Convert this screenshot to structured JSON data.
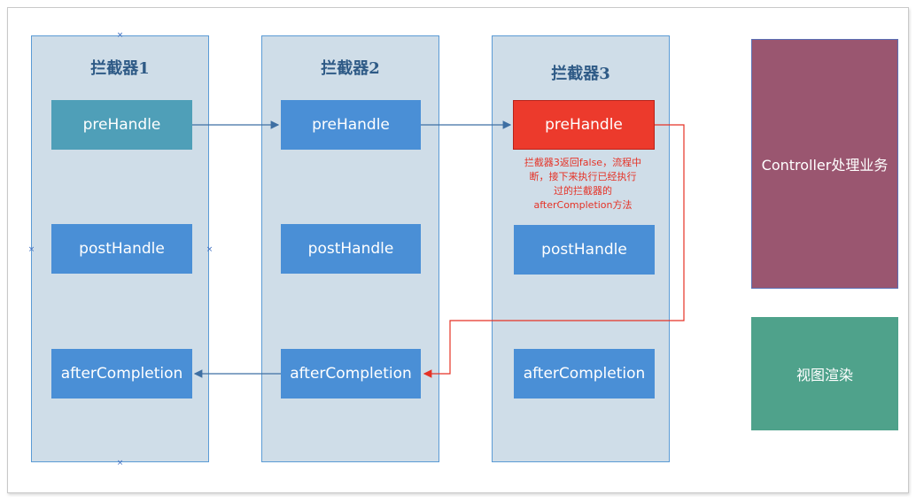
{
  "interceptors": [
    {
      "title": "拦截器1",
      "pre": "preHandle",
      "post": "postHandle",
      "after": "afterCompletion"
    },
    {
      "title": "拦截器2",
      "pre": "preHandle",
      "post": "postHandle",
      "after": "afterCompletion"
    },
    {
      "title": "拦截器3",
      "pre": "preHandle",
      "post": "postHandle",
      "after": "afterCompletion"
    }
  ],
  "note": {
    "lines": [
      "拦截器3返回false，流程中",
      "断，接下来执行已经执行",
      "过的拦截器的",
      "afterCompletion方法"
    ]
  },
  "controller": {
    "label": "Controller处理业务"
  },
  "view": {
    "label": "视图渲染"
  },
  "colors": {
    "column_bg": "#cfdde8",
    "box_blue": "#4a8fd6",
    "box_teal": "#4f9fb8",
    "box_red": "#ec3a2c",
    "controller": "#9a5670",
    "view": "#4fa28b",
    "arrow_blue": "#3e6fa3",
    "arrow_red": "#e53226"
  },
  "selection_handle_icon": "x-mark"
}
